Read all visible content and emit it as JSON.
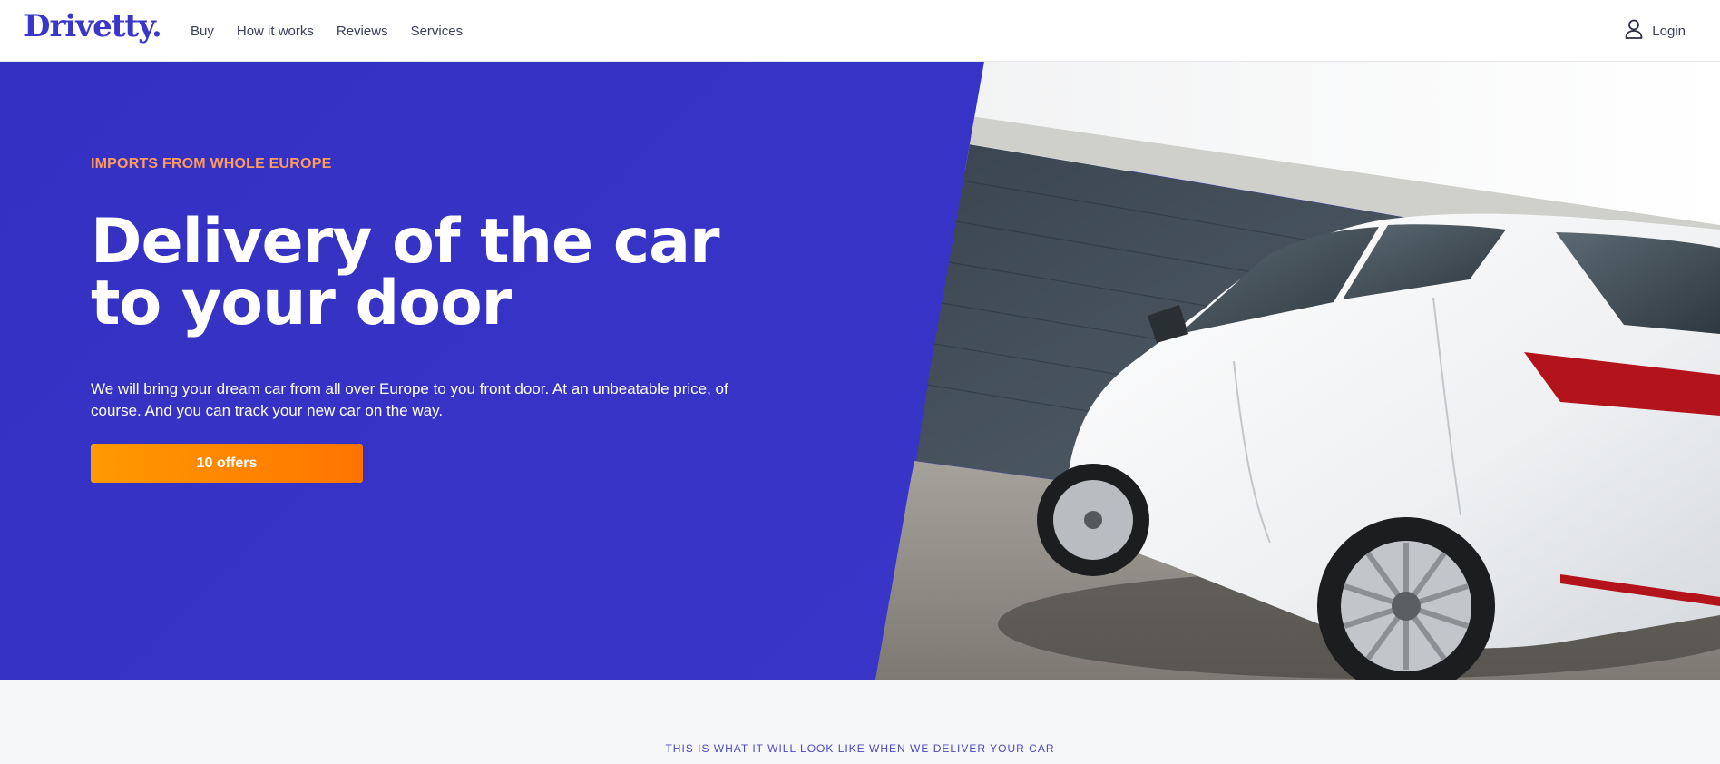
{
  "brand": {
    "logo_text": "Drivetty."
  },
  "nav": {
    "items": [
      "Buy",
      "How it works",
      "Reviews",
      "Services"
    ]
  },
  "login": {
    "label": "Login",
    "icon": "user-icon"
  },
  "hero": {
    "eyebrow": "IMPORTS FROM WHOLE EUROPE",
    "headline": "Delivery of the car to your door",
    "subtext": "We will bring your dream car from all over Europe to you front door. At an unbeatable price, of course. And you can track your new car on the way.",
    "cta_label": "10 offers",
    "image": "white-hatchback-car-photo"
  },
  "section": {
    "eyebrow": "THIS IS WHAT IT WILL LOOK LIKE WHEN WE DELIVER YOUR CAR"
  },
  "colors": {
    "brand": "#3a36c9",
    "hero_bg": "#3632c6",
    "accent_orange": "#ff8a00",
    "eyebrow_orange": "#ff9b5c",
    "page_bg": "#f6f7f9"
  }
}
